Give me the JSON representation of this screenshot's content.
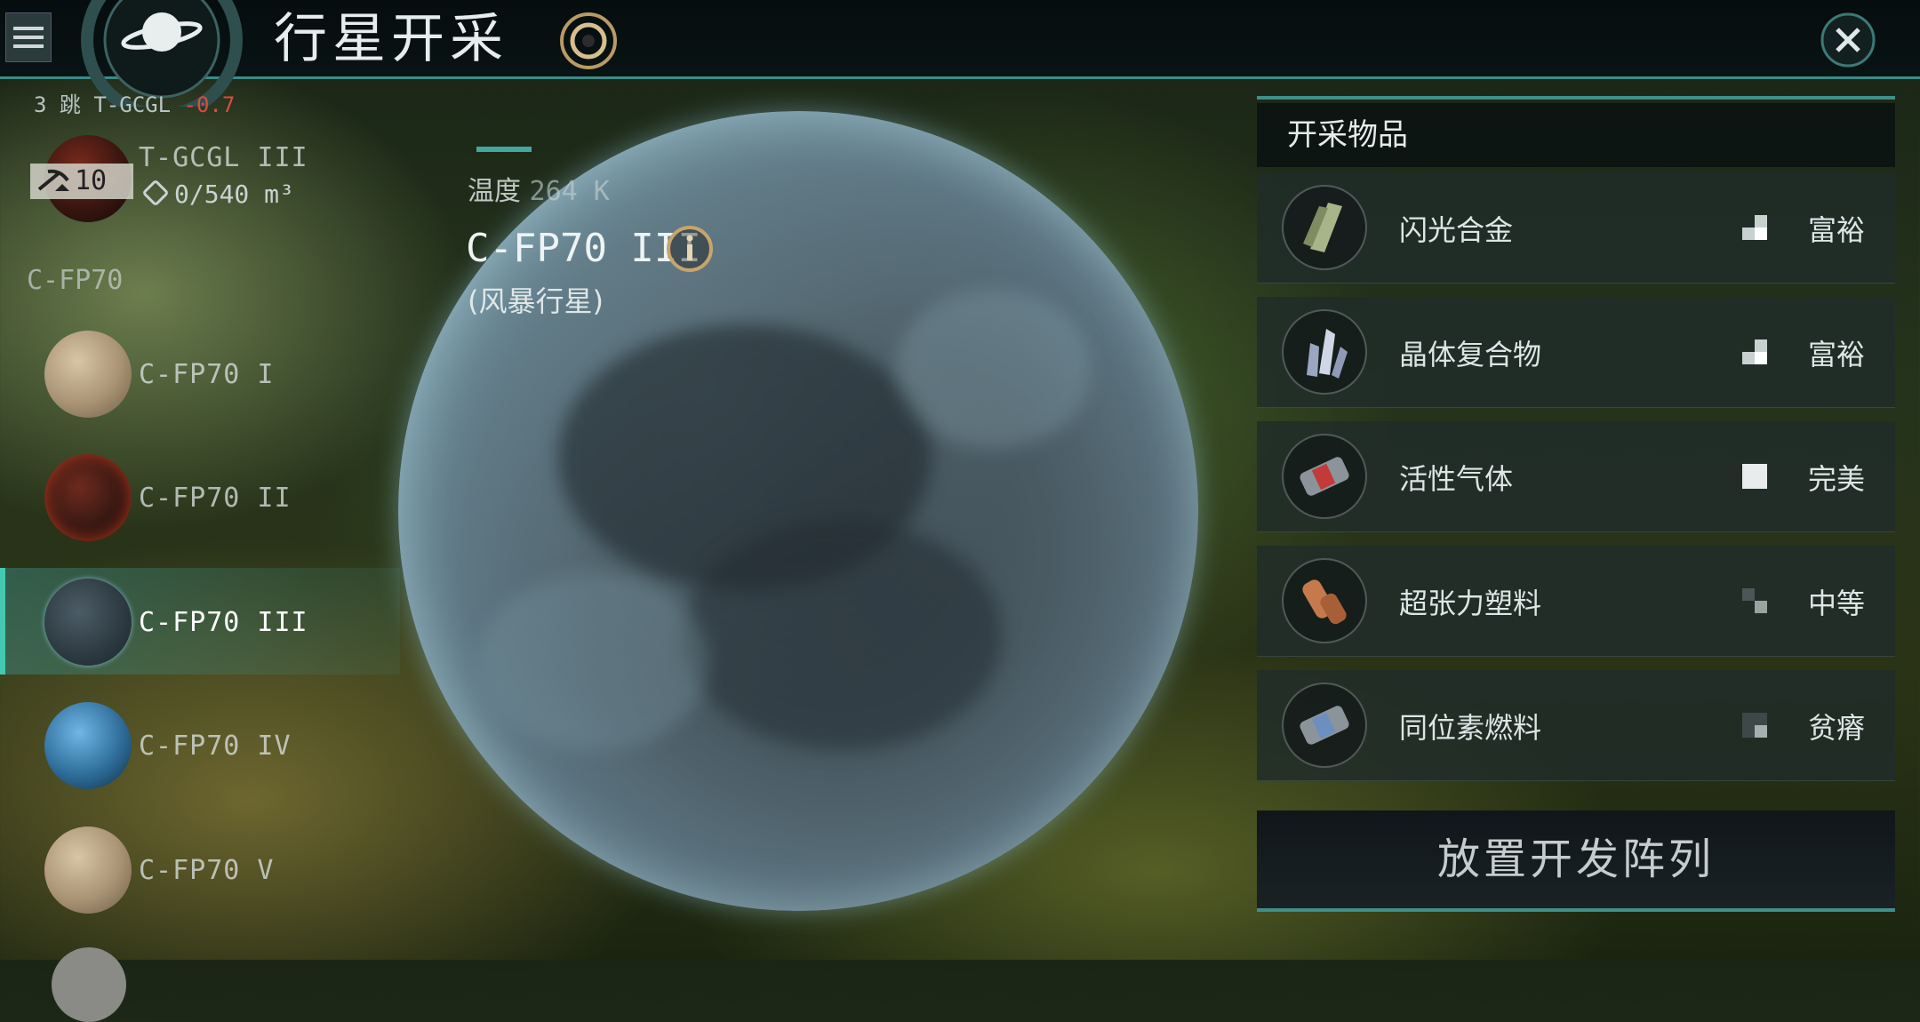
{
  "header": {
    "title": "行星开采",
    "menu_icon": "hamburger-menu-icon",
    "emblem_icon": "planet-ring-icon",
    "target_icon": "target-circle-icon",
    "close_icon": "close-x-icon"
  },
  "route": {
    "jumps": "3 跳 T-GCGL",
    "security": "-0.7"
  },
  "current_planet": {
    "name": "T-GCGL III",
    "badge_level": "10",
    "storage": "0/540 m³"
  },
  "system": {
    "name": "C-FP70",
    "planets": [
      {
        "name": "C-FP70 I",
        "kind": "barren"
      },
      {
        "name": "C-FP70 II",
        "kind": "lava"
      },
      {
        "name": "C-FP70 III",
        "kind": "storm",
        "selected": true
      },
      {
        "name": "C-FP70 IV",
        "kind": "ocean"
      },
      {
        "name": "C-FP70 V",
        "kind": "barren"
      }
    ]
  },
  "planet_detail": {
    "temp_label": "温度",
    "temp_value": "264 K",
    "name": "C-FP70 III",
    "type": "(风暴行星)",
    "info_icon": "info-circle-icon"
  },
  "resources": {
    "header": "开采物品",
    "items": [
      {
        "name": "闪光合金",
        "richness": "富裕",
        "level": 3,
        "icon": "alloy-bars-icon"
      },
      {
        "name": "晶体复合物",
        "richness": "富裕",
        "level": 3,
        "icon": "crystal-cluster-icon"
      },
      {
        "name": "活性气体",
        "richness": "完美",
        "level": 4,
        "icon": "gas-canister-icon"
      },
      {
        "name": "超张力塑料",
        "richness": "中等",
        "level": 2,
        "icon": "plastic-rolls-icon"
      },
      {
        "name": "同位素燃料",
        "richness": "贫瘠",
        "level": 1,
        "icon": "fuel-canister-icon"
      }
    ],
    "deploy_label": "放置开发阵列"
  }
}
